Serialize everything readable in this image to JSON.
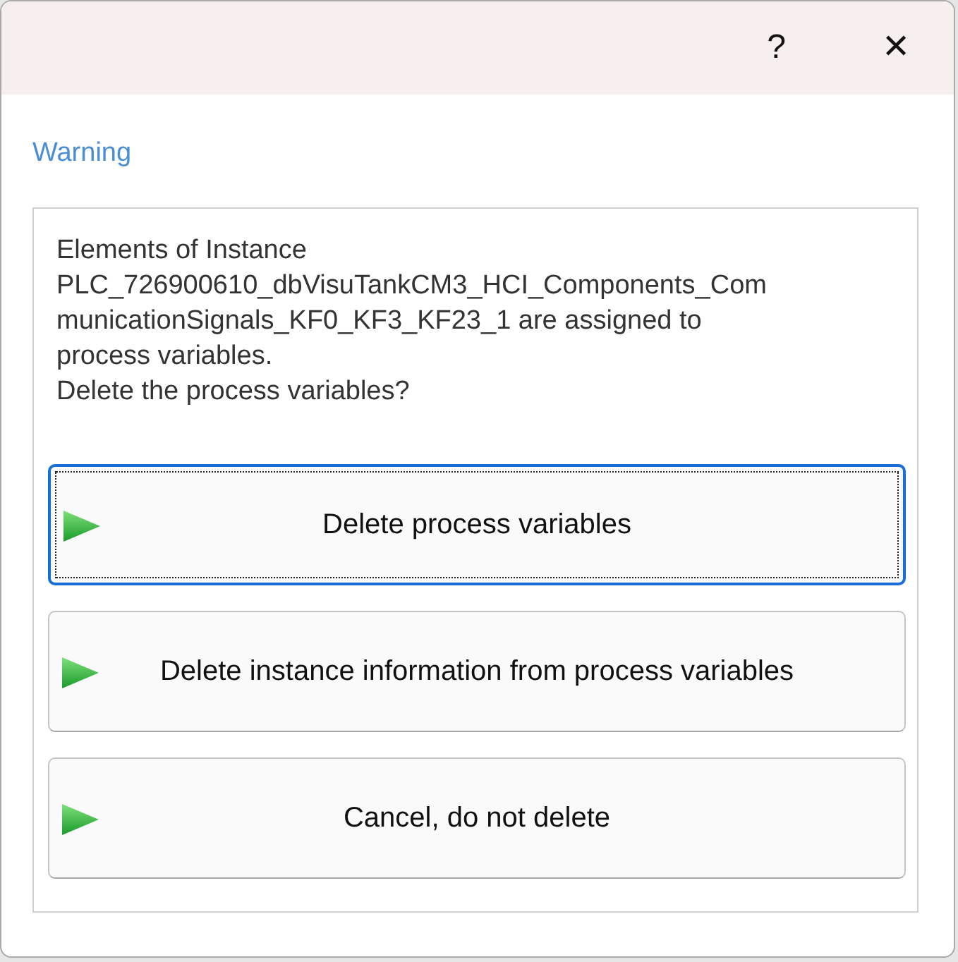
{
  "title_bar": {
    "help": "?",
    "close": "✕"
  },
  "heading": "Warning",
  "message_lines": [
    "Elements of Instance",
    "PLC_726900610_dbVisuTankCM3_HCI_Components_Com",
    "municationSignals_KF0_KF3_KF23_1 are assigned to",
    "process variables.",
    "Delete the process variables?"
  ],
  "buttons": [
    {
      "label": "Delete process variables",
      "focused": true
    },
    {
      "label": "Delete instance information from process variables",
      "focused": false
    },
    {
      "label": "Cancel, do not delete",
      "focused": false
    }
  ]
}
